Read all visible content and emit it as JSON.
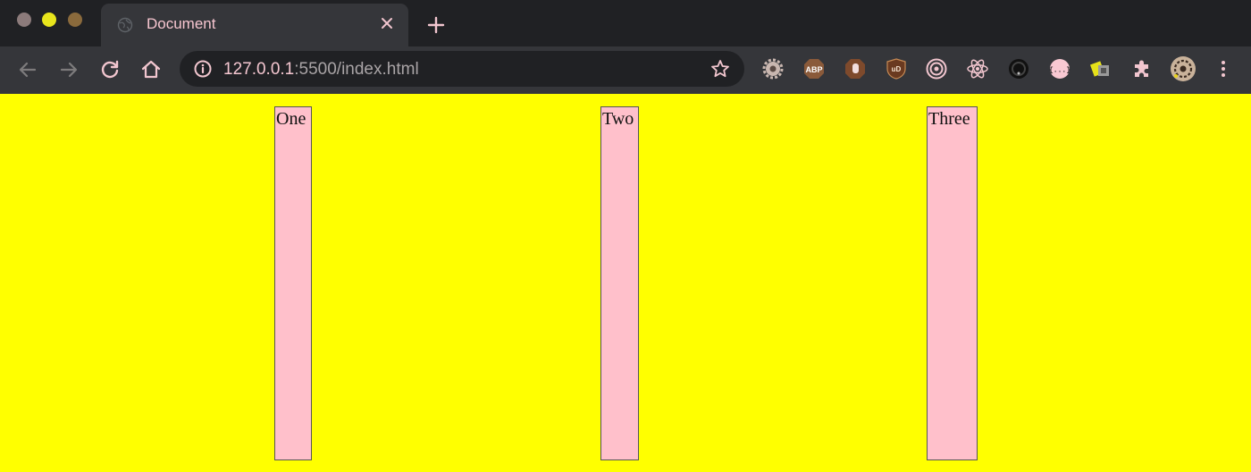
{
  "window": {
    "traffic_lights": [
      "close",
      "minimize",
      "maximize"
    ]
  },
  "tab": {
    "title": "Document",
    "favicon": "globe-icon",
    "close_icon": "close-icon"
  },
  "new_tab_icon": "plus-icon",
  "toolbar": {
    "back_icon": "back-arrow-icon",
    "forward_icon": "forward-arrow-icon",
    "reload_icon": "reload-icon",
    "home_icon": "home-icon",
    "omnibox": {
      "info_icon": "info-icon",
      "url_host": "127.0.0.1",
      "url_path": ":5500/index.html",
      "bookmark_icon": "star-icon"
    },
    "extensions": [
      {
        "name": "gear-extension-icon"
      },
      {
        "name": "adblock-plus-icon",
        "label": "ABP"
      },
      {
        "name": "stop-hand-extension-icon"
      },
      {
        "name": "ublock-origin-icon",
        "label": "uD"
      },
      {
        "name": "target-extension-icon"
      },
      {
        "name": "react-devtools-icon"
      },
      {
        "name": "dark-circle-extension-icon"
      },
      {
        "name": "json-viewer-icon",
        "label": "{...}"
      },
      {
        "name": "color-picker-extension-icon"
      },
      {
        "name": "puzzle-extensions-icon"
      },
      {
        "name": "profile-avatar"
      },
      {
        "name": "kebab-menu-icon"
      }
    ]
  },
  "page": {
    "background": "#ffff00",
    "box_color": "#ffc0cb",
    "columns": [
      "One",
      "Two",
      "Three"
    ]
  }
}
